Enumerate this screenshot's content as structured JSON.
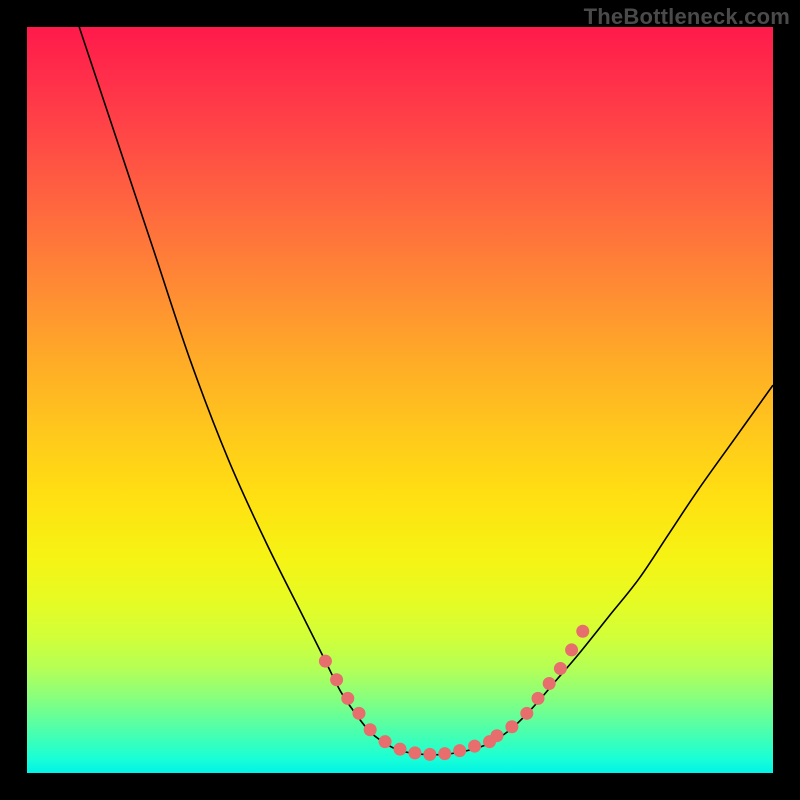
{
  "watermark": "TheBottleneck.com",
  "chart_data": {
    "type": "line",
    "title": "",
    "xlabel": "",
    "ylabel": "",
    "xlim": [
      0,
      100
    ],
    "ylim": [
      0,
      100
    ],
    "grid": false,
    "series": [
      {
        "name": "curve",
        "color": "#000000",
        "points": [
          {
            "x": 7,
            "y": 100
          },
          {
            "x": 12,
            "y": 85
          },
          {
            "x": 17,
            "y": 70
          },
          {
            "x": 22,
            "y": 55
          },
          {
            "x": 27,
            "y": 42
          },
          {
            "x": 32,
            "y": 31
          },
          {
            "x": 37,
            "y": 21
          },
          {
            "x": 40,
            "y": 15
          },
          {
            "x": 42,
            "y": 11
          },
          {
            "x": 44,
            "y": 8
          },
          {
            "x": 46,
            "y": 5.5
          },
          {
            "x": 48,
            "y": 4
          },
          {
            "x": 50,
            "y": 3
          },
          {
            "x": 53,
            "y": 2.5
          },
          {
            "x": 56,
            "y": 2.5
          },
          {
            "x": 59,
            "y": 3
          },
          {
            "x": 62,
            "y": 4
          },
          {
            "x": 65,
            "y": 6
          },
          {
            "x": 68,
            "y": 9
          },
          {
            "x": 71,
            "y": 12.5
          },
          {
            "x": 74,
            "y": 16
          },
          {
            "x": 78,
            "y": 21
          },
          {
            "x": 82,
            "y": 26
          },
          {
            "x": 86,
            "y": 32
          },
          {
            "x": 90,
            "y": 38
          },
          {
            "x": 95,
            "y": 45
          },
          {
            "x": 100,
            "y": 52
          }
        ]
      }
    ],
    "markers": [
      {
        "name": "dots-left",
        "color": "#e86d6d",
        "points": [
          {
            "x": 40,
            "y": 15
          },
          {
            "x": 41.5,
            "y": 12.5
          },
          {
            "x": 43,
            "y": 10
          },
          {
            "x": 44.5,
            "y": 8
          },
          {
            "x": 46,
            "y": 5.8
          },
          {
            "x": 48,
            "y": 4.2
          },
          {
            "x": 50,
            "y": 3.2
          },
          {
            "x": 52,
            "y": 2.7
          },
          {
            "x": 54,
            "y": 2.5
          }
        ]
      },
      {
        "name": "dots-right",
        "color": "#e86d6d",
        "points": [
          {
            "x": 56,
            "y": 2.6
          },
          {
            "x": 58,
            "y": 3.0
          },
          {
            "x": 60,
            "y": 3.6
          },
          {
            "x": 62,
            "y": 4.2
          },
          {
            "x": 63,
            "y": 5.0
          },
          {
            "x": 65,
            "y": 6.2
          },
          {
            "x": 67,
            "y": 8.0
          },
          {
            "x": 68.5,
            "y": 10.0
          },
          {
            "x": 70,
            "y": 12.0
          },
          {
            "x": 71.5,
            "y": 14.0
          },
          {
            "x": 73,
            "y": 16.5
          },
          {
            "x": 74.5,
            "y": 19.0
          }
        ]
      }
    ]
  }
}
